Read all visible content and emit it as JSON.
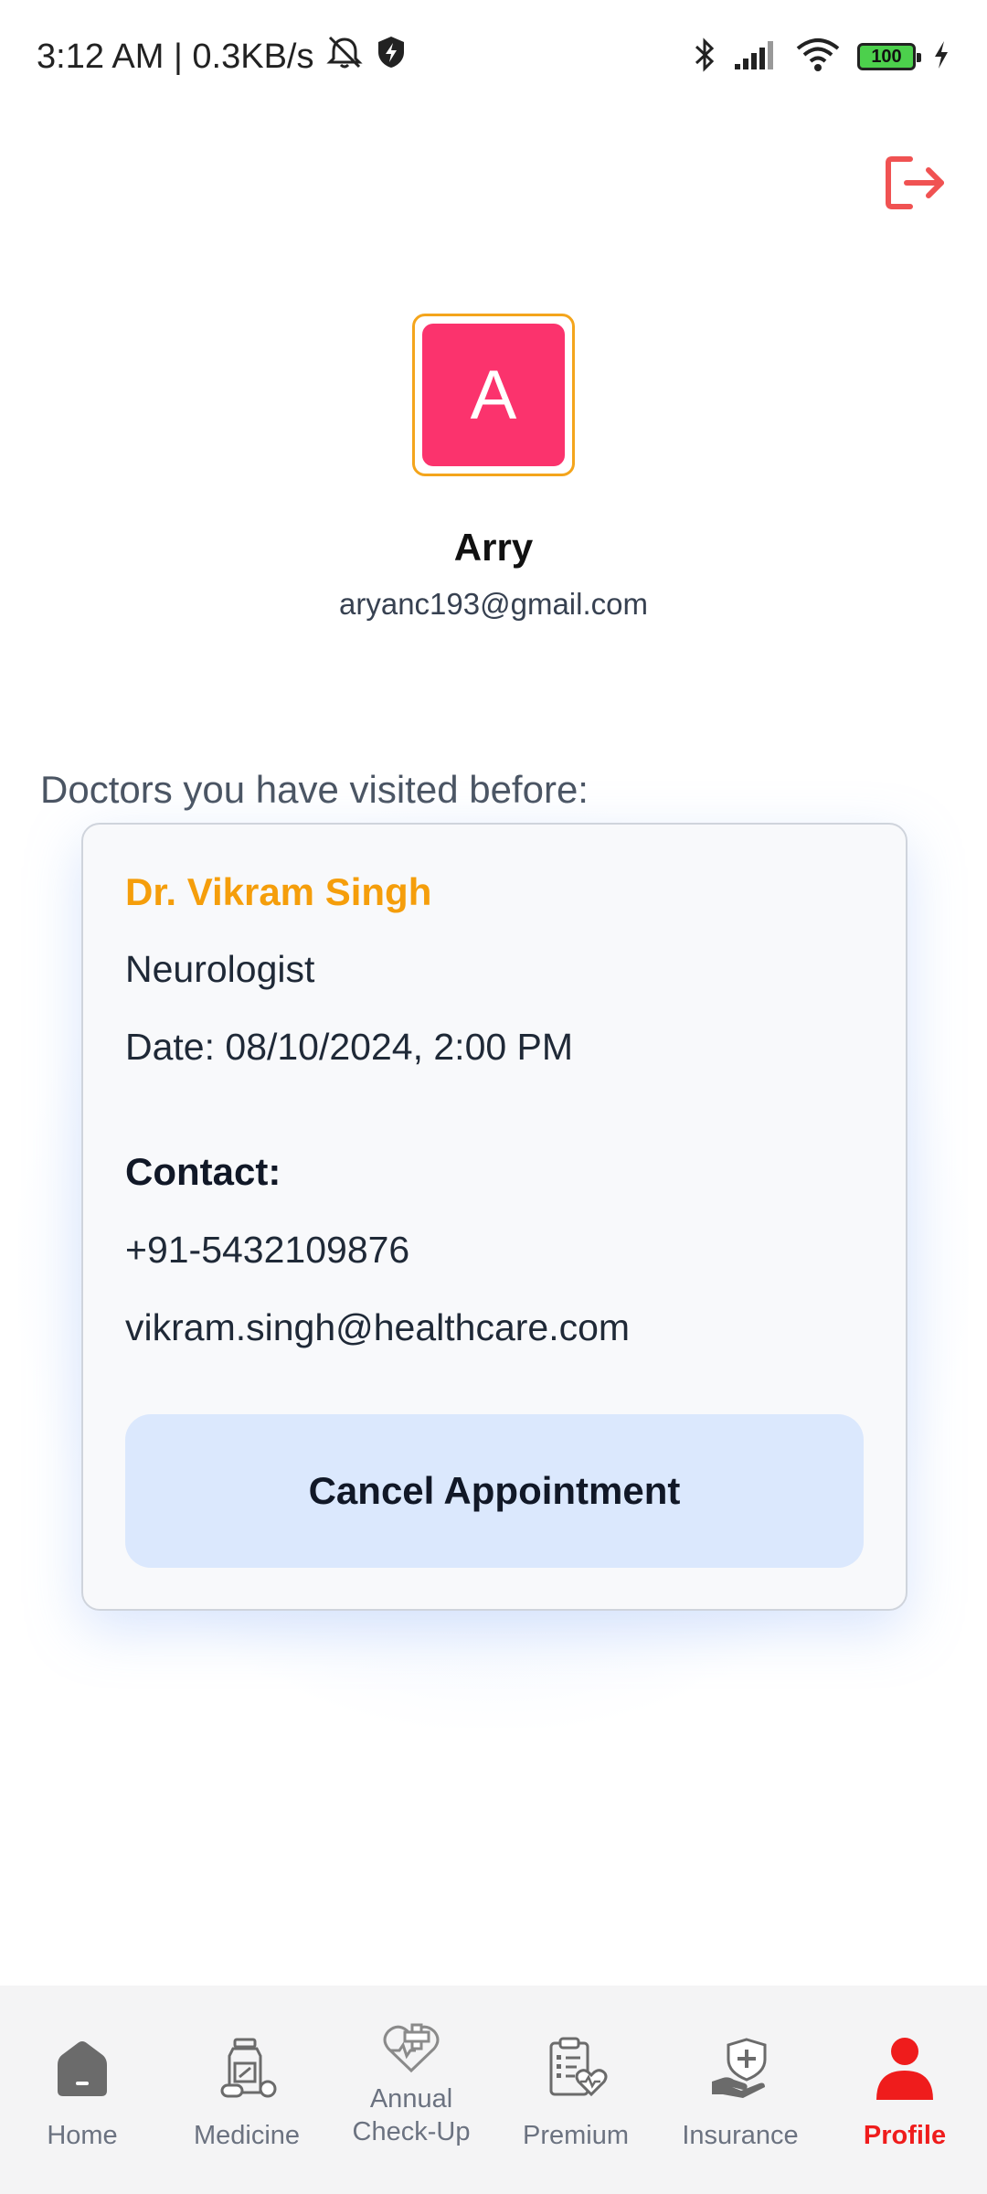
{
  "status_bar": {
    "time_speed": "3:12 AM | 0.3KB/s",
    "battery": "100"
  },
  "profile": {
    "avatar_letter": "A",
    "name": "Arry",
    "email": "aryanc193@gmail.com"
  },
  "visited": {
    "heading": "Doctors you have visited before:",
    "doctor": {
      "name": "Dr. Vikram Singh",
      "specialty": "Neurologist",
      "date": "Date: 08/10/2024, 2:00 PM",
      "contact_label": "Contact:",
      "phone": "+91-5432109876",
      "email": "vikram.singh@healthcare.com",
      "cancel_label": "Cancel Appointment"
    }
  },
  "colors": {
    "accent_orange": "#f59e0b",
    "avatar_pink": "#fb336d",
    "logout_red": "#f05252",
    "active_red": "#ef1c1c"
  },
  "nav": {
    "home": "Home",
    "medicine": "Medicine",
    "annual_line1": "Annual",
    "annual_line2": "Check-Up",
    "premium": "Premium",
    "insurance": "Insurance",
    "profile": "Profile",
    "active": "profile"
  }
}
